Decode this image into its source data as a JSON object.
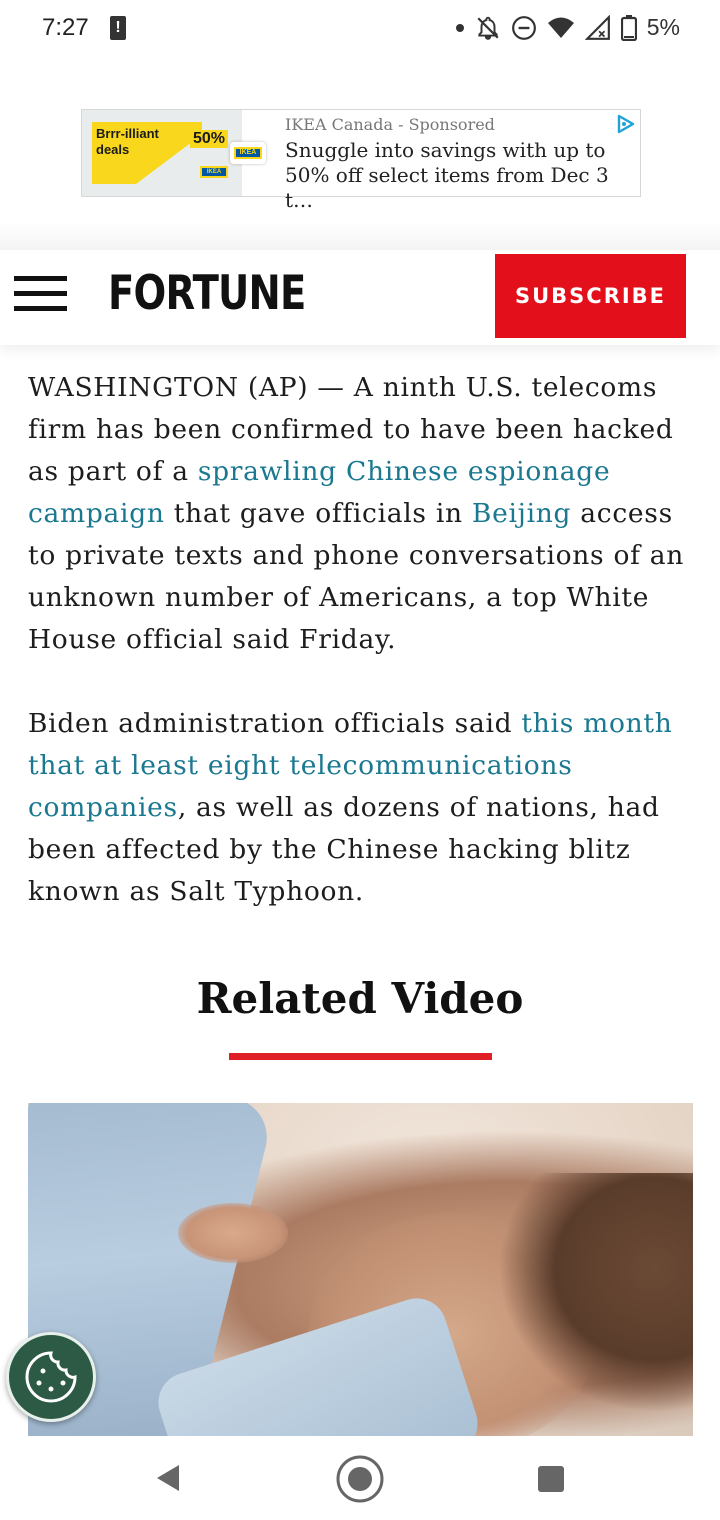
{
  "status_bar": {
    "time": "7:27",
    "alert_glyph": "!",
    "battery_text": "5%",
    "icons": [
      "dot-icon",
      "notifications-off-icon",
      "do-not-disturb-icon",
      "wifi-icon",
      "signal-icon",
      "battery-icon"
    ]
  },
  "ad": {
    "image_text": "Brrr-illiant deals",
    "image_percent": "50%",
    "brand_logo": "IKEA",
    "sponsor": "IKEA Canada - Sponsored",
    "headline": "Snuggle into savings with up to 50% off select items from Dec 3 t…",
    "ad_choices_icon": "ad-choices-icon"
  },
  "header": {
    "logo": "FORTUNE",
    "subscribe_label": "SUBSCRIBE",
    "menu_icon": "hamburger-menu-icon"
  },
  "article": {
    "p1": {
      "before_link1": "WASHINGTON (AP) — A ninth U.S. telecoms firm has been confirmed to have been hacked as part of a ",
      "link1": "sprawling Chinese espionage campaign",
      "between": " that gave officials in ",
      "link2": "Beijing",
      "after": " access to private texts and phone conversations of an unknown number of Americans, a top White House official said Friday."
    },
    "p2": {
      "before": "Biden administration officials said ",
      "link": "this month that at least eight telecommunications companies",
      "after": ", as well as dozens of nations, had been affected by the Chinese hacking blitz known as Salt Typhoon."
    }
  },
  "related": {
    "title": "Related Video"
  },
  "cookie_button": {
    "icon": "cookie-icon"
  },
  "nav_bar": {
    "back_icon": "back-triangle-icon",
    "home_icon": "home-circle-icon",
    "recents_icon": "recents-square-icon"
  },
  "colors": {
    "brand_red": "#e3101b",
    "link": "#1a7890",
    "cookie_bg": "#2c5a45",
    "ikea_yellow": "#f9d71c",
    "ikea_blue": "#0058a3"
  }
}
